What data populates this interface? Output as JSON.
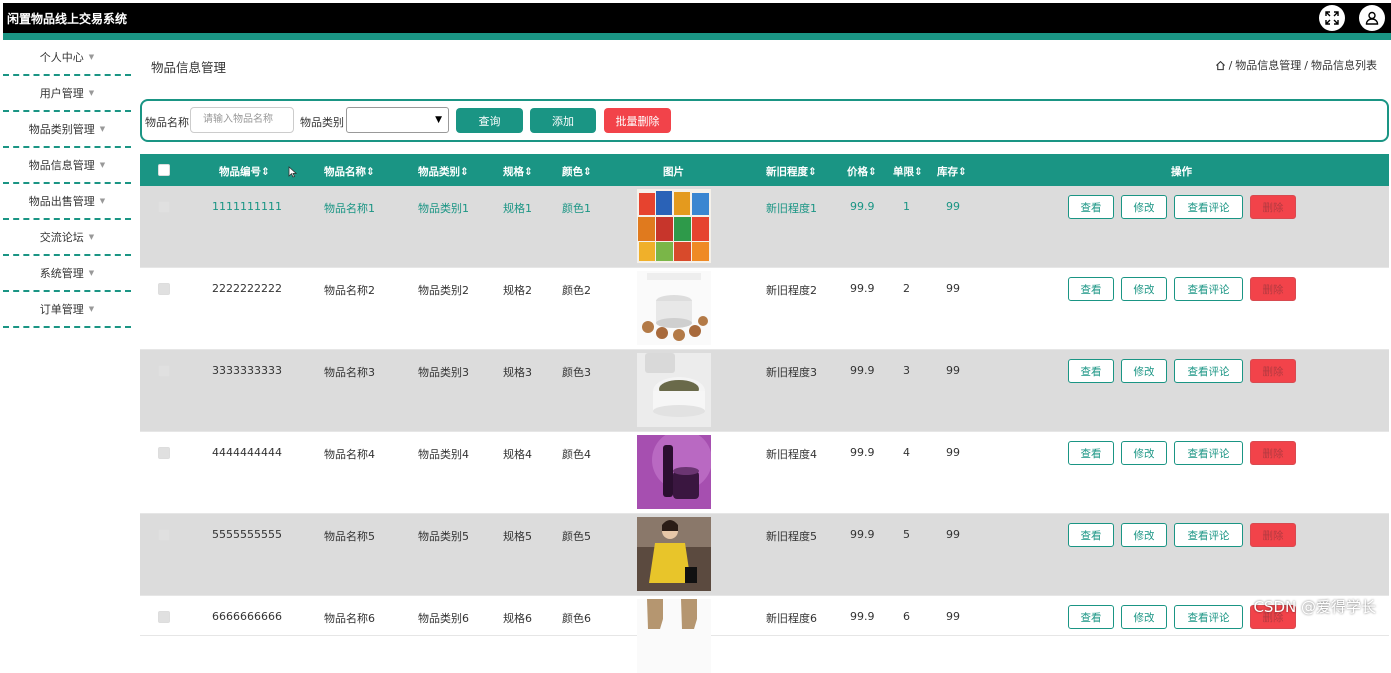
{
  "app": {
    "title": "闲置物品线上交易系统"
  },
  "sidebar": {
    "items": [
      {
        "label": "个人中心"
      },
      {
        "label": "用户管理"
      },
      {
        "label": "物品类别管理"
      },
      {
        "label": "物品信息管理"
      },
      {
        "label": "物品出售管理"
      },
      {
        "label": "交流论坛"
      },
      {
        "label": "系统管理"
      },
      {
        "label": "订单管理"
      }
    ]
  },
  "page": {
    "title": "物品信息管理",
    "breadcrumb": [
      "物品信息管理",
      "物品信息列表"
    ],
    "breadcrumb_sep": "/"
  },
  "search": {
    "name_label": "物品名称",
    "name_placeholder": "请输入物品名称",
    "category_label": "物品类别",
    "category_value": "",
    "query_btn": "查询",
    "add_btn": "添加",
    "batch_delete_btn": "批量删除"
  },
  "table": {
    "headers": {
      "id": "物品编号",
      "name": "物品名称",
      "category": "物品类别",
      "spec": "规格",
      "color": "颜色",
      "image": "图片",
      "condition": "新旧程度",
      "price": "价格",
      "limit": "单限",
      "stock": "库存",
      "actions": "操作"
    },
    "sort_glyph": "⇕",
    "actions": {
      "view": "查看",
      "edit": "修改",
      "reviews": "查看评论",
      "delete": "删除"
    },
    "rows": [
      {
        "id": "1111111111",
        "name": "物品名称1",
        "category": "物品类别1",
        "spec": "规格1",
        "color": "颜色1",
        "image": "snack-bags-image",
        "condition": "新旧程度1",
        "price": "99.9",
        "limit": "1",
        "stock": "99"
      },
      {
        "id": "2222222222",
        "name": "物品名称2",
        "category": "物品类别2",
        "spec": "规格2",
        "color": "颜色2",
        "image": "rice-cooker-image",
        "condition": "新旧程度2",
        "price": "99.9",
        "limit": "2",
        "stock": "99"
      },
      {
        "id": "3333333333",
        "name": "物品名称3",
        "category": "物品类别3",
        "spec": "规格3",
        "color": "颜色3",
        "image": "cream-jar-image",
        "condition": "新旧程度3",
        "price": "99.9",
        "limit": "3",
        "stock": "99"
      },
      {
        "id": "4444444444",
        "name": "物品名称4",
        "category": "物品类别4",
        "spec": "规格4",
        "color": "颜色4",
        "image": "cosmetics-purple-image",
        "condition": "新旧程度4",
        "price": "99.9",
        "limit": "4",
        "stock": "99"
      },
      {
        "id": "5555555555",
        "name": "物品名称5",
        "category": "物品类别5",
        "spec": "规格5",
        "color": "颜色5",
        "image": "yellow-sweater-image",
        "condition": "新旧程度5",
        "price": "99.9",
        "limit": "5",
        "stock": "99"
      },
      {
        "id": "6666666666",
        "name": "物品名称6",
        "category": "物品类别6",
        "spec": "规格6",
        "color": "颜色6",
        "image": "boots-image",
        "condition": "新旧程度6",
        "price": "99.9",
        "limit": "6",
        "stock": "99"
      }
    ]
  },
  "watermark": "CSDN @爱得学长",
  "colors": {
    "accent": "#1a9584",
    "danger": "#f2434a",
    "topbar": "#000000"
  }
}
